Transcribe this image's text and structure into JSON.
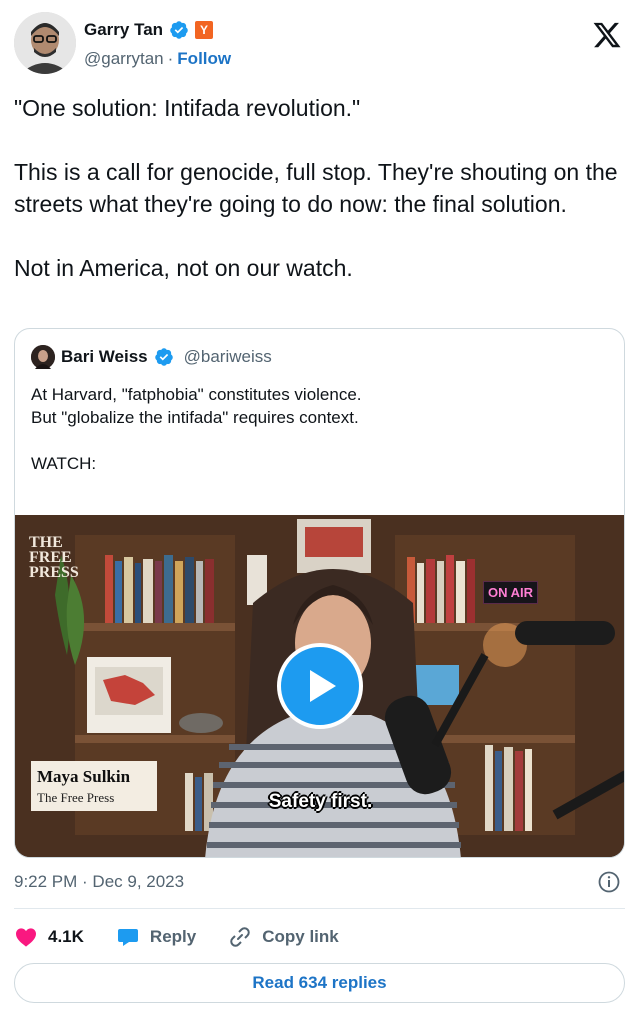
{
  "author": {
    "display_name": "Garry Tan",
    "handle": "@garrytan",
    "separator": "·",
    "follow_label": "Follow",
    "badge_label": "Y"
  },
  "tweet": {
    "text": "\"One solution: Intifada revolution.\"\n\nThis is a call for genocide, full stop. They're shouting on the streets what they're going to do now: the final solution.\n\nNot in America, not on our watch."
  },
  "quoted_tweet": {
    "display_name": "Bari Weiss",
    "handle": "@bariweiss",
    "text": "At Harvard, \"fatphobia\" constitutes violence.\nBut \"globalize the intifada\" requires context.\n\nWATCH:",
    "video": {
      "logo_text": "THE FREE PRESS",
      "on_air": "ON AIR",
      "lower_third_name": "Maya Sulkin",
      "lower_third_org": "The Free Press",
      "caption": "Safety first."
    }
  },
  "meta": {
    "timestamp": "9:22 PM · Dec 9, 2023"
  },
  "actions": {
    "like_count": "4.1K",
    "reply_label": "Reply",
    "copy_link_label": "Copy link"
  },
  "footer": {
    "read_replies_label": "Read 634 replies"
  },
  "colors": {
    "link_blue": "#1d74c6",
    "verified_blue": "#1d9bf0",
    "like_pink": "#f91880",
    "yc_orange": "#f26522"
  }
}
